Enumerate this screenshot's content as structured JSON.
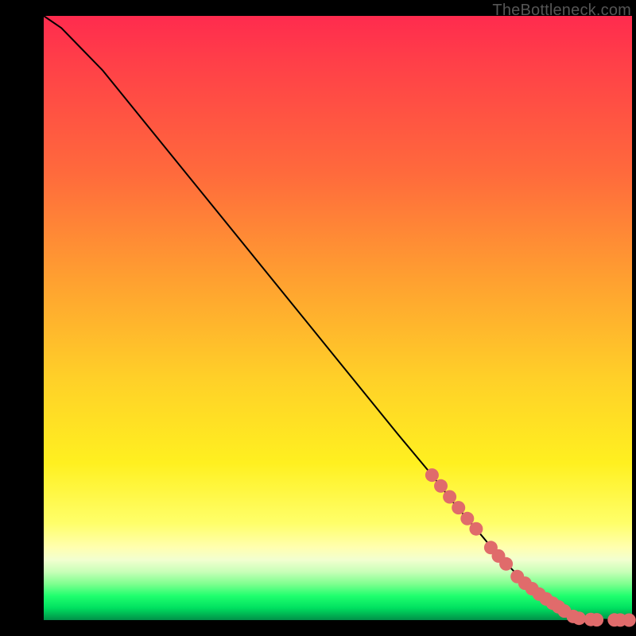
{
  "watermark": "TheBottleneck.com",
  "colors": {
    "marker": "#e06b6b",
    "curve": "#000000",
    "bg_top": "#ff2b4e",
    "bg_bottom": "#009048"
  },
  "chart_data": {
    "type": "line",
    "title": "",
    "xlabel": "",
    "ylabel": "",
    "xlim": [
      0,
      100
    ],
    "ylim": [
      0,
      100
    ],
    "grid": false,
    "legend": false,
    "annotations": [
      "TheBottleneck.com"
    ],
    "series": [
      {
        "name": "bottleneck-curve",
        "comment": "x is normalized horizontal position (0=left edge of plot, 100=right). y is normalized bottleneck % (100=top red, 0=bottom green). Curve starts top-left, descends nearly linearly, flattens to ~0 at far right.",
        "x": [
          0,
          3,
          6,
          10,
          15,
          20,
          30,
          40,
          50,
          60,
          66,
          70,
          74,
          77,
          79,
          81,
          83,
          85,
          87,
          88.5,
          90,
          92,
          94,
          96,
          98,
          100
        ],
        "y": [
          100,
          98,
          95,
          91,
          85,
          79,
          67,
          55,
          43,
          31,
          24,
          19,
          14.5,
          11,
          9,
          7,
          5.2,
          3.6,
          2.2,
          1.2,
          0.5,
          0.2,
          0.1,
          0.05,
          0.02,
          0
        ]
      }
    ],
    "markers": {
      "comment": "Salmon dots clustered along the lower-right portion of the curve and along the floor at far right.",
      "x": [
        66,
        67.5,
        69,
        70.5,
        72,
        73.5,
        76,
        77.3,
        78.6,
        80.5,
        81.8,
        83,
        84.2,
        85.4,
        86.5,
        87.5,
        88.5,
        90,
        91,
        93,
        94,
        97,
        98,
        99.5
      ],
      "y": [
        24,
        22.2,
        20.4,
        18.6,
        16.8,
        15.1,
        12,
        10.6,
        9.3,
        7.2,
        6.1,
        5.2,
        4.3,
        3.5,
        2.8,
        2.2,
        1.5,
        0.6,
        0.3,
        0.1,
        0.05,
        0.02,
        0.01,
        0
      ]
    }
  }
}
